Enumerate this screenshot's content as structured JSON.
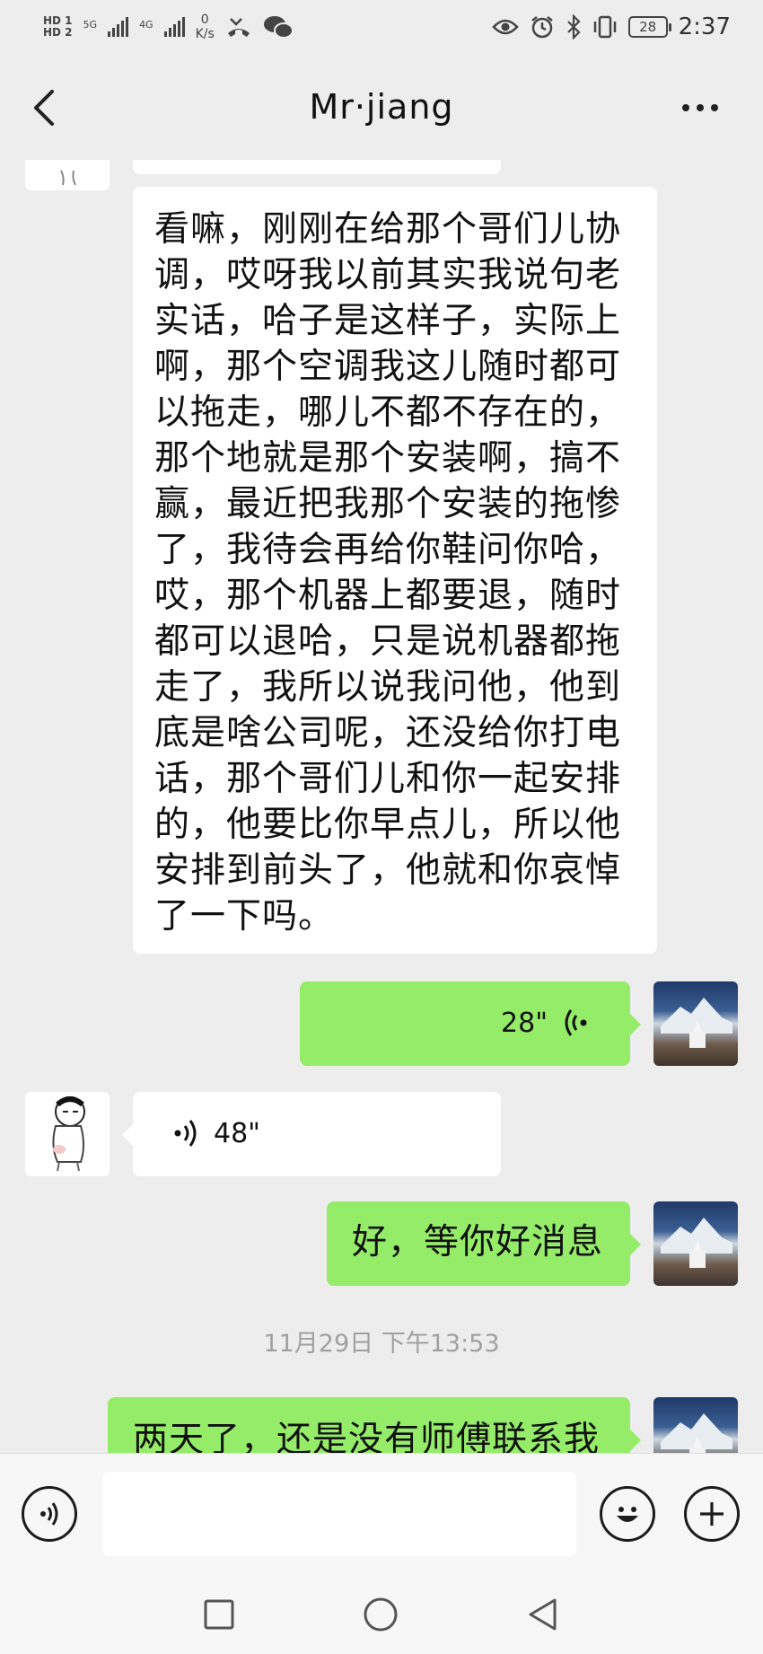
{
  "status_bar": {
    "sim1": "HD 1",
    "sim2": "HD 2",
    "net1": "5G",
    "net2": "4G",
    "speed_value": "0",
    "speed_unit": "K/s",
    "battery": "28",
    "time": "2:37"
  },
  "nav": {
    "title": "Mr·jiang"
  },
  "messages": {
    "long_text": "看嘛，刚刚在给那个哥们儿协调，哎呀我以前其实我说句老实话，哈子是这样子，实际上啊，那个空调我这儿随时都可以拖走，哪儿不都不存在的，那个地就是那个安装啊，搞不赢，最近把我那个安装的拖惨了，我待会再给你鞋问你哈，哎，那个机器上都要退，随时都可以退哈，只是说机器都拖走了，我所以说我问他，他到底是啥公司呢，还没给你打电话，那个哥们儿和你一起安排的，他要比你早点儿，所以他安排到前头了，他就和你哀悼了一下吗。",
    "long_text_lines": [
      "看嘛，刚刚在给那个哥们儿协",
      "调，哎呀我以前其实我说句老",
      "实话，哈子是这样子，实际上",
      "啊，那个空调我这儿随时都可",
      "以拖走，哪儿不都不存在的，",
      "那个地就是那个安装啊，搞不",
      "赢，最近把我那个安装的拖惨",
      "了，我待会再给你鞋问你哈，",
      "哎，那个机器上都要退，随时",
      "都可以退哈，只是说机器都拖",
      "走了，我所以说我问他，他到",
      "底是啥公司呢，还没给你打电",
      "话，那个哥们儿和你一起安排",
      "的，他要比你早点儿，所以他",
      "安排到前头了，他就和你哀悼",
      "了一下吗。"
    ],
    "voice_out_duration": "28\"",
    "voice_in_duration": "48\"",
    "reply_text": "好，等你好消息",
    "timestamp": "11月29日 下午13:53",
    "last_text": "两天了，还是没有师傅联系我"
  },
  "icons": {
    "back": "chevron-left-icon",
    "more": "more-dots-icon",
    "voice_input": "voice-input-icon",
    "emoji": "emoji-icon",
    "add": "plus-icon",
    "recent": "square-icon",
    "home": "circle-icon",
    "back_sys": "triangle-back-icon"
  },
  "colors": {
    "background": "#ededed",
    "bubble_green": "#95ec69",
    "bubble_white": "#ffffff",
    "timestamp": "#a0a0a0"
  }
}
